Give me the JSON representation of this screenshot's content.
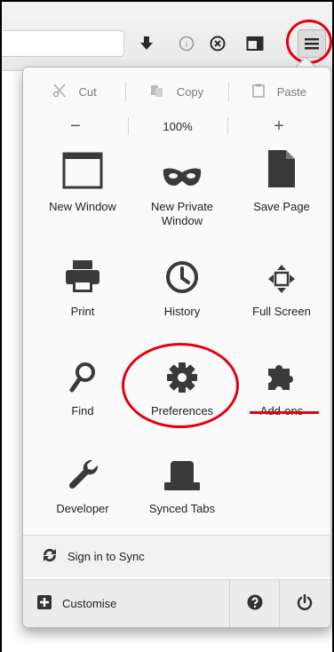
{
  "toolbar": {
    "icons": [
      "download-icon",
      "reader-icon",
      "pocket-icon",
      "sidebar-icon",
      "hamburger-menu-icon"
    ]
  },
  "edit": {
    "cut": "Cut",
    "copy": "Copy",
    "paste": "Paste"
  },
  "zoom": {
    "out": "−",
    "level": "100%",
    "in": "+"
  },
  "items": {
    "new_window": "New Window",
    "new_private_window": "New Private Window",
    "save_page": "Save Page",
    "print": "Print",
    "history": "History",
    "full_screen": "Full Screen",
    "find": "Find",
    "preferences": "Preferences",
    "add_ons": "Add-ons",
    "developer": "Developer",
    "synced_tabs": "Synced Tabs"
  },
  "footer": {
    "sign_in": "Sign in to Sync",
    "customise": "Customise"
  },
  "colors": {
    "annotation": "#e3000f",
    "icon": "#3a3a3a"
  }
}
